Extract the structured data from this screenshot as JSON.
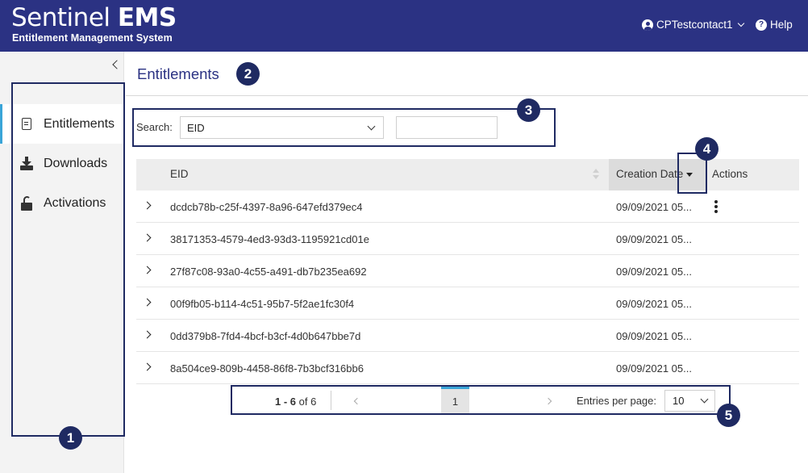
{
  "header": {
    "brand_name": "Sentinel",
    "brand_product": "EMS",
    "brand_subtitle": "Entitlement Management System",
    "user_name": "CPTestcontact1",
    "help_label": "Help"
  },
  "sidebar": {
    "items": [
      {
        "label": "Entitlements",
        "icon": "document-icon",
        "active": true
      },
      {
        "label": "Downloads",
        "icon": "download-icon",
        "active": false
      },
      {
        "label": "Activations",
        "icon": "unlock-icon",
        "active": false
      }
    ]
  },
  "main": {
    "title": "Entitlements",
    "search": {
      "label": "Search:",
      "field_value": "EID",
      "input_value": "",
      "input_placeholder": ""
    },
    "table": {
      "columns": [
        "EID",
        "Creation Date",
        "Actions"
      ],
      "sorted_column": "Creation Date",
      "sort_direction": "descending",
      "rows": [
        {
          "eid": "dcdcb78b-c25f-4397-8a96-647efd379ec4",
          "date": "09/09/2021 05..."
        },
        {
          "eid": "38171353-4579-4ed3-93d3-1195921cd01e",
          "date": "09/09/2021 05..."
        },
        {
          "eid": "27f87c08-93a0-4c55-a491-db7b235ea692",
          "date": "09/09/2021 05..."
        },
        {
          "eid": "00f9fb05-b114-4c51-95b7-5f2ae1fc30f4",
          "date": "09/09/2021 05..."
        },
        {
          "eid": "0dd379b8-7fd4-4bcf-b3cf-4d0b647bbe7d",
          "date": "09/09/2021 05..."
        },
        {
          "eid": "8a504ce9-809b-4458-86f8-7b3bcf316bb6",
          "date": "09/09/2021 05..."
        }
      ]
    },
    "pagination": {
      "range": "1 - 6",
      "of_label": "of 6",
      "current_page": "1",
      "entries_label": "Entries per page:",
      "entries_value": "10"
    }
  },
  "callouts": [
    "1",
    "2",
    "3",
    "4",
    "5"
  ],
  "colors": {
    "header_bg": "#2b3283",
    "accent": "#3aa5d8",
    "title_text": "#2b3283",
    "callout": "#1f2a62"
  }
}
